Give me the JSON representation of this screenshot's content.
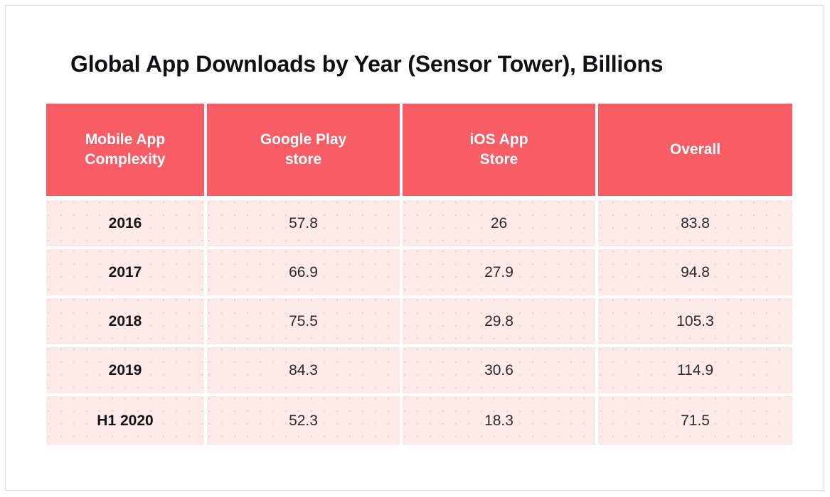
{
  "page": {
    "title": "Global App Downloads by Year (Sensor Tower), Billions",
    "background_color": "#ffffff",
    "frame_border_color": "#dadada"
  },
  "colors": {
    "header_background": "#f85c64",
    "header_text": "#ffffff",
    "cell_background": "#fceae8",
    "cell_text": "#2b2b2d",
    "label_text": "#141416",
    "title_text": "#111113",
    "grid_gap": "#ffffff"
  },
  "chart_data": {
    "type": "table",
    "title": "Global App Downloads by Year (Sensor Tower), Billions",
    "xlabel": "",
    "ylabel": "",
    "categories": [
      "2016",
      "2017",
      "2018",
      "2019",
      "H1 2020"
    ],
    "columns": [
      "Mobile App Complexity",
      "Google Play store",
      "iOS App Store",
      "Overall"
    ],
    "series": [
      {
        "name": "Google Play store",
        "values": [
          57.8,
          66.9,
          75.5,
          84.3,
          52.3
        ]
      },
      {
        "name": "iOS App Store",
        "values": [
          26,
          27.9,
          29.8,
          30.6,
          18.3
        ]
      },
      {
        "name": "Overall",
        "values": [
          83.8,
          94.8,
          105.3,
          114.9,
          71.5
        ]
      }
    ],
    "rows": [
      {
        "label": "2016",
        "google_play": "57.8",
        "ios_app_store": "26",
        "overall": "83.8"
      },
      {
        "label": "2017",
        "google_play": "66.9",
        "ios_app_store": "27.9",
        "overall": "94.8"
      },
      {
        "label": "2018",
        "google_play": "75.5",
        "ios_app_store": "29.8",
        "overall": "105.3"
      },
      {
        "label": "2019",
        "google_play": "84.3",
        "ios_app_store": "30.6",
        "overall": "114.9"
      },
      {
        "label": "H1 2020",
        "google_play": "52.3",
        "ios_app_store": "18.3",
        "overall": "71.5"
      }
    ],
    "units": "Billions",
    "source": "Sensor Tower"
  },
  "table": {
    "headers": [
      {
        "label": "Mobile App Complexity",
        "lines": [
          "Mobile App",
          "Complexity"
        ]
      },
      {
        "label": "Google Play store",
        "lines": [
          "Google Play",
          "store"
        ]
      },
      {
        "label": "iOS App Store",
        "lines": [
          "iOS App",
          "Store"
        ]
      },
      {
        "label": "Overall",
        "lines": [
          "Overall"
        ]
      }
    ],
    "rows": [
      {
        "cells": [
          "2016",
          "57.8",
          "26",
          "83.8"
        ]
      },
      {
        "cells": [
          "2017",
          "66.9",
          "27.9",
          "94.8"
        ]
      },
      {
        "cells": [
          "2018",
          "75.5",
          "29.8",
          "105.3"
        ]
      },
      {
        "cells": [
          "2019",
          "84.3",
          "30.6",
          "114.9"
        ]
      },
      {
        "cells": [
          "H1 2020",
          "52.3",
          "18.3",
          "71.5"
        ]
      }
    ]
  }
}
